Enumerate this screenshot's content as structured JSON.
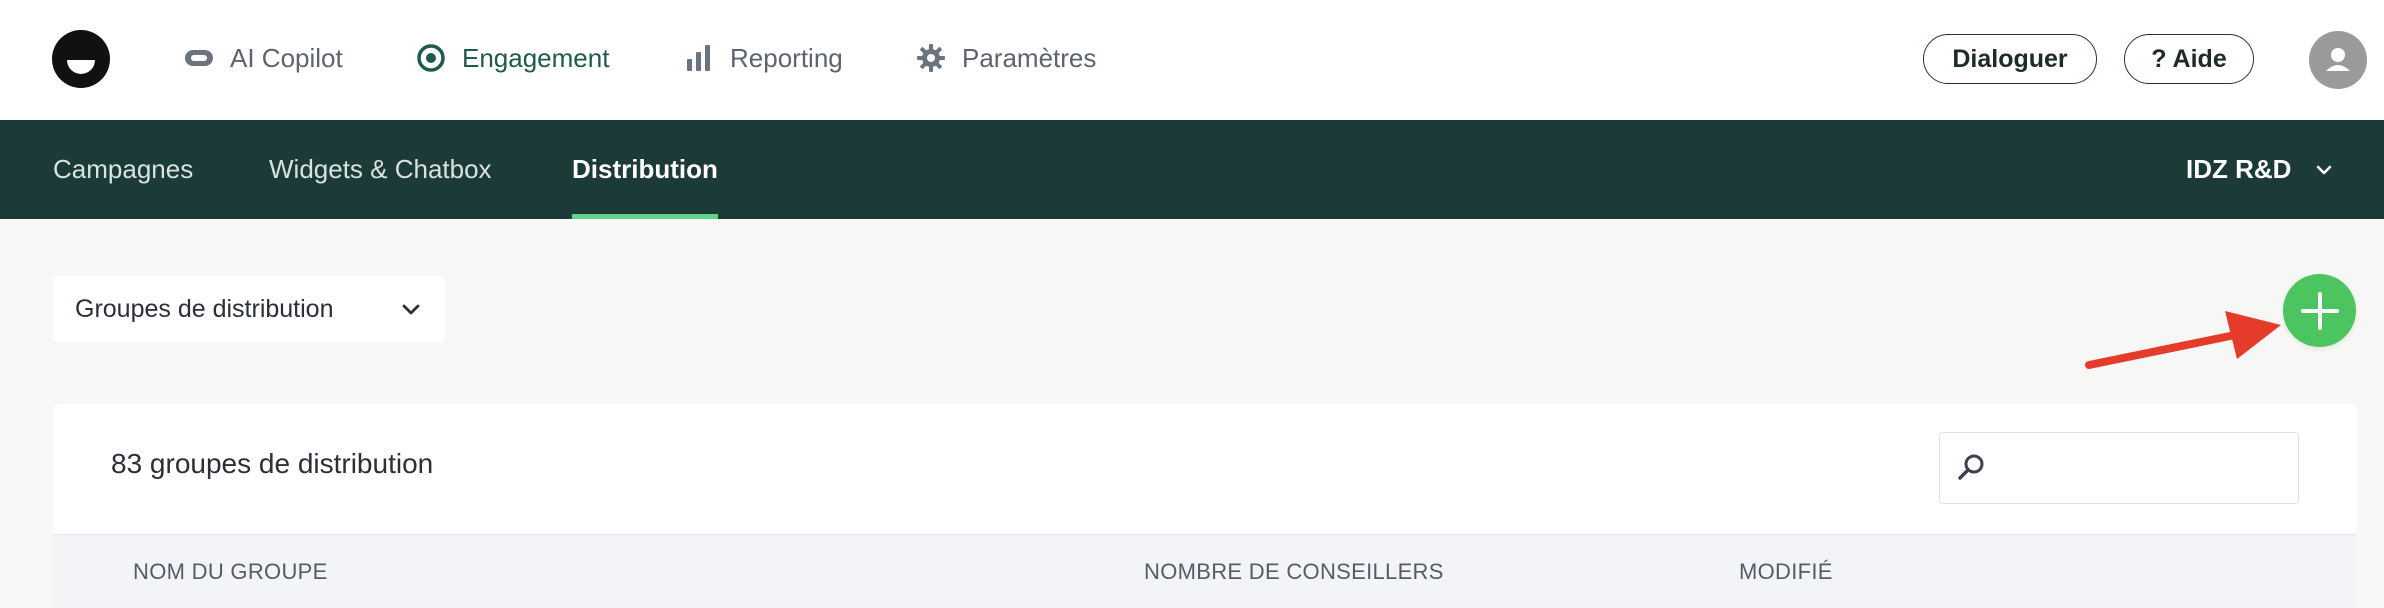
{
  "topnav": {
    "items": [
      {
        "label": "AI Copilot",
        "icon": "copilot-icon"
      },
      {
        "label": "Engagement",
        "icon": "target-icon",
        "active": true
      },
      {
        "label": "Reporting",
        "icon": "bar-chart-icon"
      },
      {
        "label": "Paramètres",
        "icon": "gear-icon"
      }
    ],
    "dialoguer_label": "Dialoguer",
    "aide_label": "? Aide"
  },
  "subnav": {
    "tabs": [
      {
        "label": "Campagnes"
      },
      {
        "label": "Widgets & Chatbox"
      },
      {
        "label": "Distribution",
        "active": true
      }
    ],
    "org_label": "IDZ R&D"
  },
  "content": {
    "view_selector": "Groupes de distribution",
    "card_title": "83 groupes de distribution",
    "search_placeholder": "",
    "table_headers": [
      "NOM DU GROUPE",
      "NOMBRE DE CONSEILLERS",
      "MODIFIÉ"
    ]
  },
  "colors": {
    "brand_dark": "#1c3a38",
    "active_tab_underline": "#5fd38a",
    "add_button": "#4cc45f",
    "annotation_arrow": "#e53b2a"
  }
}
